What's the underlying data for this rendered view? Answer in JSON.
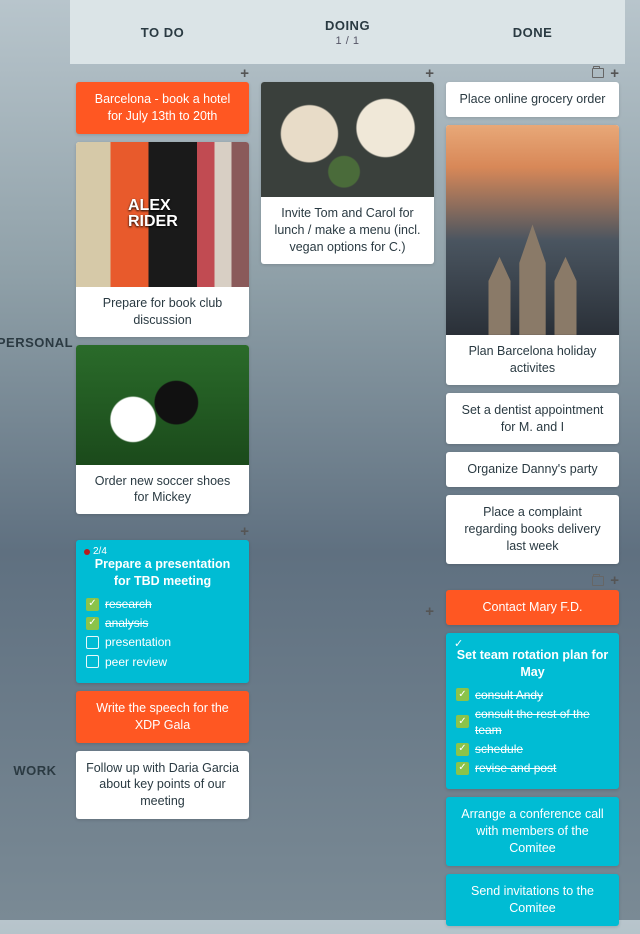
{
  "columns": {
    "todo": {
      "title": "TO DO"
    },
    "doing": {
      "title": "DOING",
      "count": "1 / 1"
    },
    "done": {
      "title": "DONE"
    }
  },
  "rows": {
    "personal": {
      "title": "PERSONAL"
    },
    "work": {
      "title": "WORK"
    }
  },
  "personal": {
    "todo": {
      "card0": "Barcelona - book a hotel for July 13th to 20th",
      "card1": "Prepare for book club discussion",
      "card2": "Order new soccer shoes for Mickey"
    },
    "doing": {
      "card0": "Invite Tom and Carol for lunch / make a menu (incl. vegan options for C.)"
    },
    "done": {
      "card0": "Place online grocery order",
      "card1": "Plan Barcelona holiday activites",
      "card2": "Set a dentist appointment for M. and I",
      "card3": "Organize Danny's party",
      "card4": "Place a complaint regarding books delivery last week"
    }
  },
  "work": {
    "todo": {
      "presentation": {
        "counter": "2/4",
        "title": "Prepare a presentation for TBD meeting",
        "items": [
          {
            "label": "research",
            "done": true
          },
          {
            "label": "analysis",
            "done": true
          },
          {
            "label": "presentation",
            "done": false
          },
          {
            "label": "peer review",
            "done": false
          }
        ]
      },
      "card1": "Write the speech for the XDP Gala",
      "card2": "Follow up with Daria Garcia about key points of our meeting"
    },
    "done": {
      "card0": "Contact Mary F.D.",
      "rotation": {
        "title": "Set team rotation plan for May",
        "items": [
          {
            "label": "consult Andy",
            "done": true
          },
          {
            "label": "consult the rest of the team",
            "done": true
          },
          {
            "label": "schedule",
            "done": true
          },
          {
            "label": "revise and post",
            "done": true
          }
        ]
      },
      "card2": "Arrange a conference call with members of the Comitee",
      "card3": "Send invitations to the Comitee"
    }
  }
}
